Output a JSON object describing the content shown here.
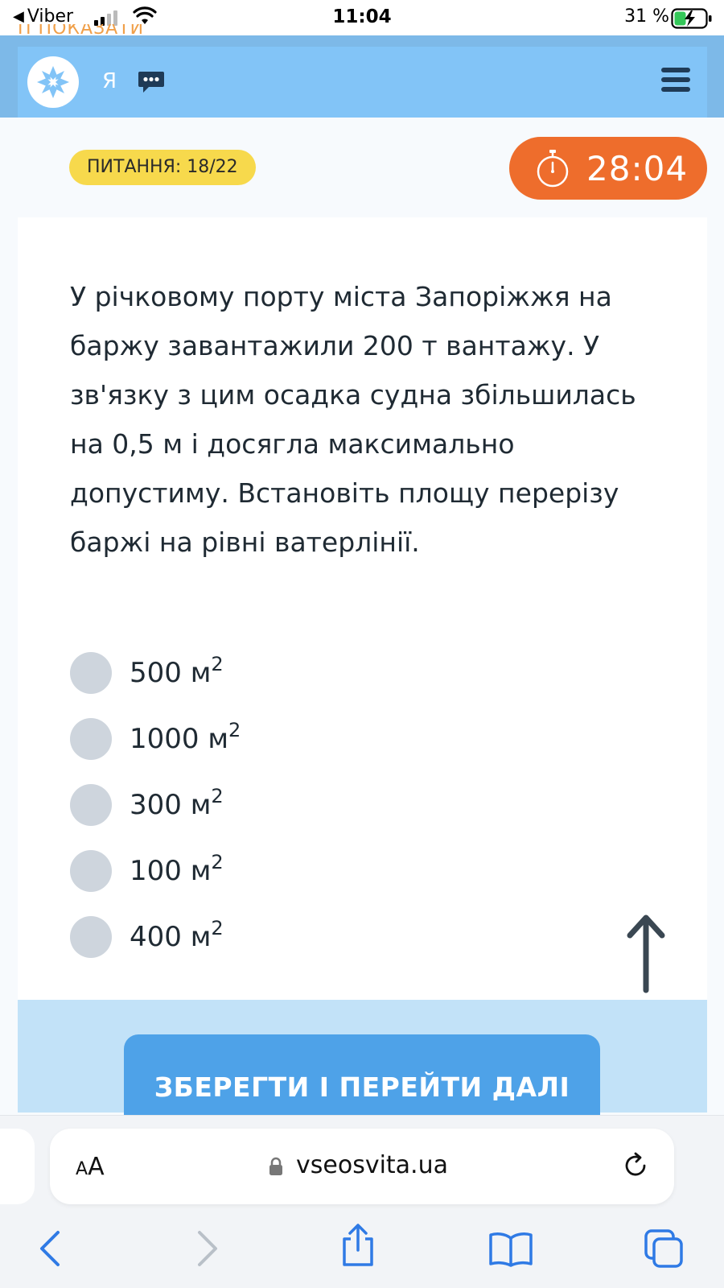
{
  "status_bar": {
    "back_app": "Viber",
    "time": "11:04",
    "battery": "31 %"
  },
  "header": {
    "ghost_text": "П ПОКАЗАТИ",
    "user_initial": "Я",
    "icons": [
      "logo-ornament-icon",
      "chat-icon",
      "menu-icon"
    ]
  },
  "quiz": {
    "question_counter": "ПИТАННЯ: 18/22",
    "timer": "28:04",
    "question": "У річковому порту міста Запоріжжя на баржу завантажили 200 т вантажу. У зв'язку з цим осадка судна збільшилась на 0,5 м і досягла максимально допустиму. Встановіть площу перерізу баржі на рівні ватерлінії.",
    "options": [
      {
        "value": "500 м",
        "sup": "2"
      },
      {
        "value": "1000 м",
        "sup": "2"
      },
      {
        "value": "300 м",
        "sup": "2"
      },
      {
        "value": "100 м",
        "sup": "2"
      },
      {
        "value": "400 м",
        "sup": "2"
      }
    ],
    "save_button": "ЗБЕРЕГТИ І ПЕРЕЙТИ ДАЛІ"
  },
  "browser": {
    "text_size_label_small": "A",
    "text_size_label_large": "A",
    "url": "vseosvita.ua"
  },
  "colors": {
    "header_blue": "#82c4f7",
    "badge_yellow": "#f7d94c",
    "timer_orange": "#ee6d2c",
    "button_blue": "#4ea2e8"
  }
}
